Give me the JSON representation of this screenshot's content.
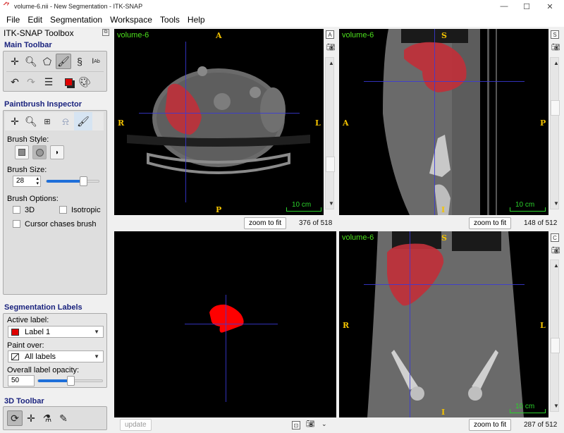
{
  "window": {
    "title": "volume-6.nii - New Segmentation - ITK-SNAP",
    "controls": {
      "minimize": "—",
      "maximize": "☐",
      "close": "✕"
    }
  },
  "menu": [
    "File",
    "Edit",
    "Segmentation",
    "Workspace",
    "Tools",
    "Help"
  ],
  "toolbox": {
    "title": "ITK-SNAP Toolbox",
    "main_toolbar": {
      "title": "Main Toolbar",
      "row1": [
        "crosshair-tool",
        "zoom-tool",
        "polygon-tool",
        "paintbrush-tool",
        "snake-tool",
        "annotation-tool"
      ],
      "row2": [
        "undo",
        "redo",
        "layers",
        "label-color",
        "palette"
      ],
      "active_tool": "paintbrush-tool"
    },
    "paintbrush_inspector": {
      "title": "Paintbrush Inspector",
      "tools": [
        "crosshair",
        "zoom",
        "grid",
        "adaptive-brush",
        "paintbrush"
      ],
      "brush_style_label": "Brush Style:",
      "brush_styles": [
        "square",
        "round",
        "adaptive"
      ],
      "selected_style": "round",
      "brush_size_label": "Brush Size:",
      "brush_size": "28",
      "brush_size_slider_fraction": 0.7,
      "brush_options_label": "Brush Options:",
      "options": [
        {
          "label": "3D",
          "checked": false
        },
        {
          "label": "Isotropic",
          "checked": false
        },
        {
          "label": "Cursor chases brush",
          "checked": false
        }
      ]
    },
    "segmentation_labels": {
      "title": "Segmentation Labels",
      "active_label_caption": "Active label:",
      "active_label": "Label 1",
      "active_label_color": "#e00000",
      "paint_over_caption": "Paint over:",
      "paint_over": "All labels",
      "opacity_caption": "Overall label opacity:",
      "opacity": "50",
      "opacity_slider_fraction": 0.5
    },
    "toolbar_3d": {
      "title": "3D Toolbar",
      "tools": [
        "rotate-3d",
        "crosshair-3d",
        "spray",
        "scalpel"
      ]
    }
  },
  "views": {
    "axial": {
      "volume": "volume-6",
      "top": "A",
      "bottom": "P",
      "left": "R",
      "right": "L",
      "scale": "10 cm",
      "layout_btn": "A",
      "zoom_btn": "zoom to fit",
      "slice": "376 of 518"
    },
    "sagittal": {
      "volume": "volume-6",
      "top": "S",
      "bottom": "I",
      "left": "A",
      "right": "P",
      "scale": "10 cm",
      "layout_btn": "S",
      "zoom_btn": "zoom to fit",
      "slice": "148 of 512"
    },
    "render3d": {
      "update_btn": "update"
    },
    "coronal": {
      "volume": "volume-6",
      "top": "S",
      "bottom": "I",
      "left": "R",
      "right": "L",
      "scale": "10 cm",
      "layout_btn": "C",
      "zoom_btn": "zoom to fit",
      "slice": "287 of 512"
    }
  },
  "colors": {
    "segmentation": "#c0303a",
    "crosshair": "#3a3ad8",
    "orientation": "#f5c400",
    "volume_label": "#4ce01d",
    "section_title": "#1a237e"
  }
}
